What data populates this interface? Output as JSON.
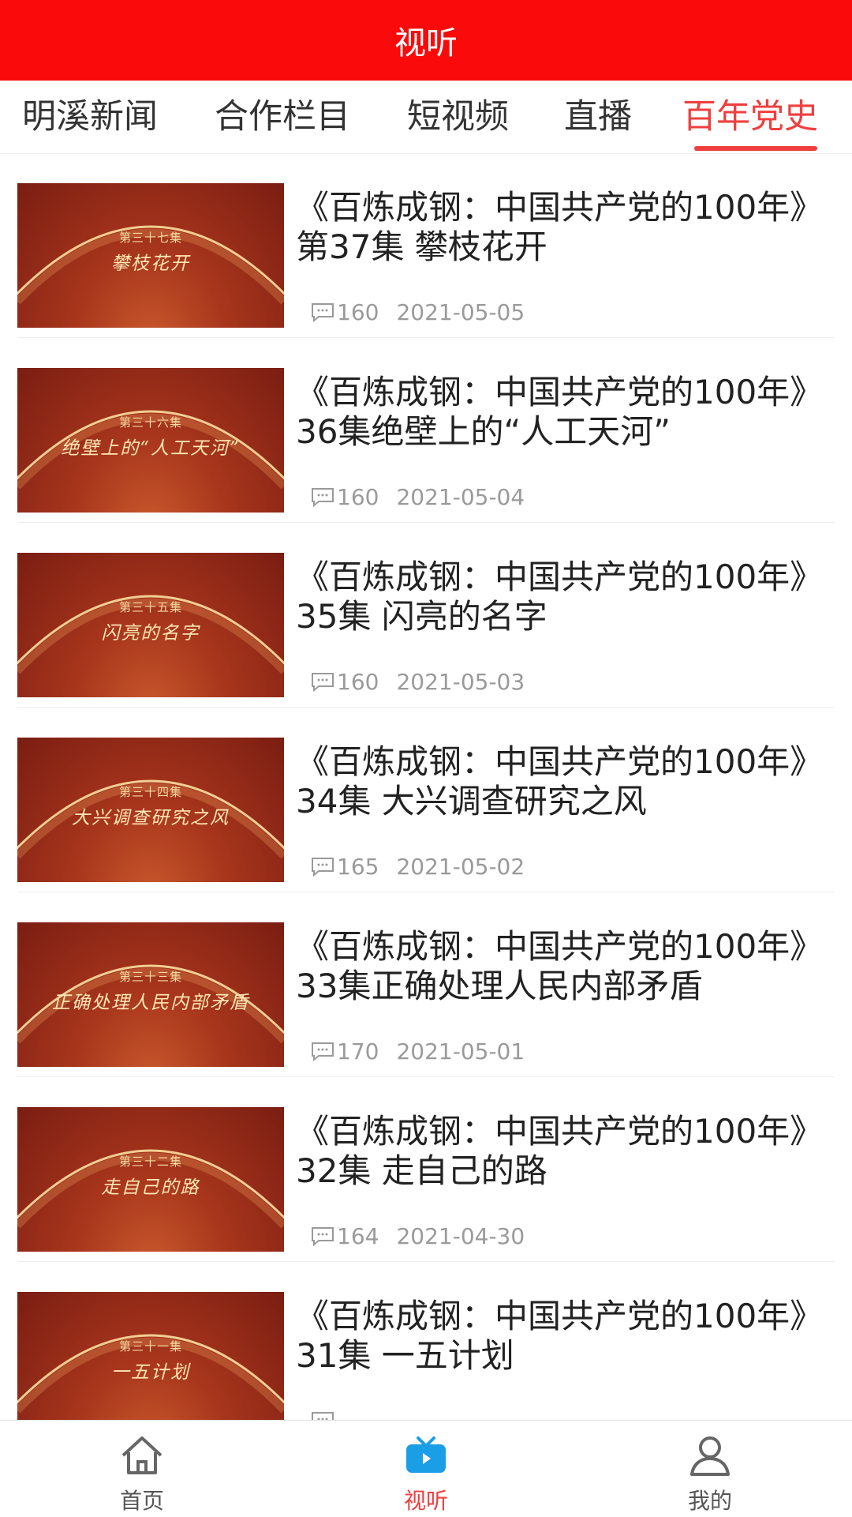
{
  "header": {
    "title": "视听"
  },
  "tabs": [
    {
      "label": "明溪新闻",
      "active": false
    },
    {
      "label": "合作栏目",
      "active": false
    },
    {
      "label": "短视频",
      "active": false
    },
    {
      "label": "直播",
      "active": false
    },
    {
      "label": "百年党史",
      "active": true
    }
  ],
  "items": [
    {
      "title": "《百炼成钢：中国共产党的100年》第37集 攀枝花开",
      "comments": "160",
      "date": "2021-05-05",
      "thumb_episode": "第三十七集",
      "thumb_subtitle": "攀枝花开"
    },
    {
      "title": "《百炼成钢：中国共产党的100年》36集绝壁上的“人工天河”",
      "comments": "160",
      "date": "2021-05-04",
      "thumb_episode": "第三十六集",
      "thumb_subtitle": "绝壁上的“人工天河”"
    },
    {
      "title": "《百炼成钢：中国共产党的100年》35集 闪亮的名字",
      "comments": "160",
      "date": "2021-05-03",
      "thumb_episode": "第三十五集",
      "thumb_subtitle": "闪亮的名字"
    },
    {
      "title": "《百炼成钢：中国共产党的100年》34集 大兴调查研究之风",
      "comments": "165",
      "date": "2021-05-02",
      "thumb_episode": "第三十四集",
      "thumb_subtitle": "大兴调查研究之风"
    },
    {
      "title": "《百炼成钢：中国共产党的100年》33集正确处理人民内部矛盾",
      "comments": "170",
      "date": "2021-05-01",
      "thumb_episode": "第三十三集",
      "thumb_subtitle": "正确处理人民内部矛盾"
    },
    {
      "title": "《百炼成钢：中国共产党的100年》32集 走自己的路",
      "comments": "164",
      "date": "2021-04-30",
      "thumb_episode": "第三十二集",
      "thumb_subtitle": "走自己的路"
    },
    {
      "title": "《百炼成钢：中国共产党的100年》31集 一五计划",
      "comments": "",
      "date": "",
      "thumb_episode": "第三十一集",
      "thumb_subtitle": "一五计划"
    }
  ],
  "bottom_nav": [
    {
      "label": "首页",
      "icon": "home-icon",
      "active": false
    },
    {
      "label": "视听",
      "icon": "tv-icon",
      "active": true
    },
    {
      "label": "我的",
      "icon": "user-icon",
      "active": false
    }
  ],
  "colors": {
    "brand_red": "#fa0a0a",
    "active_tab": "#ef3f3f",
    "nav_active_icon": "#1a9ee6"
  }
}
